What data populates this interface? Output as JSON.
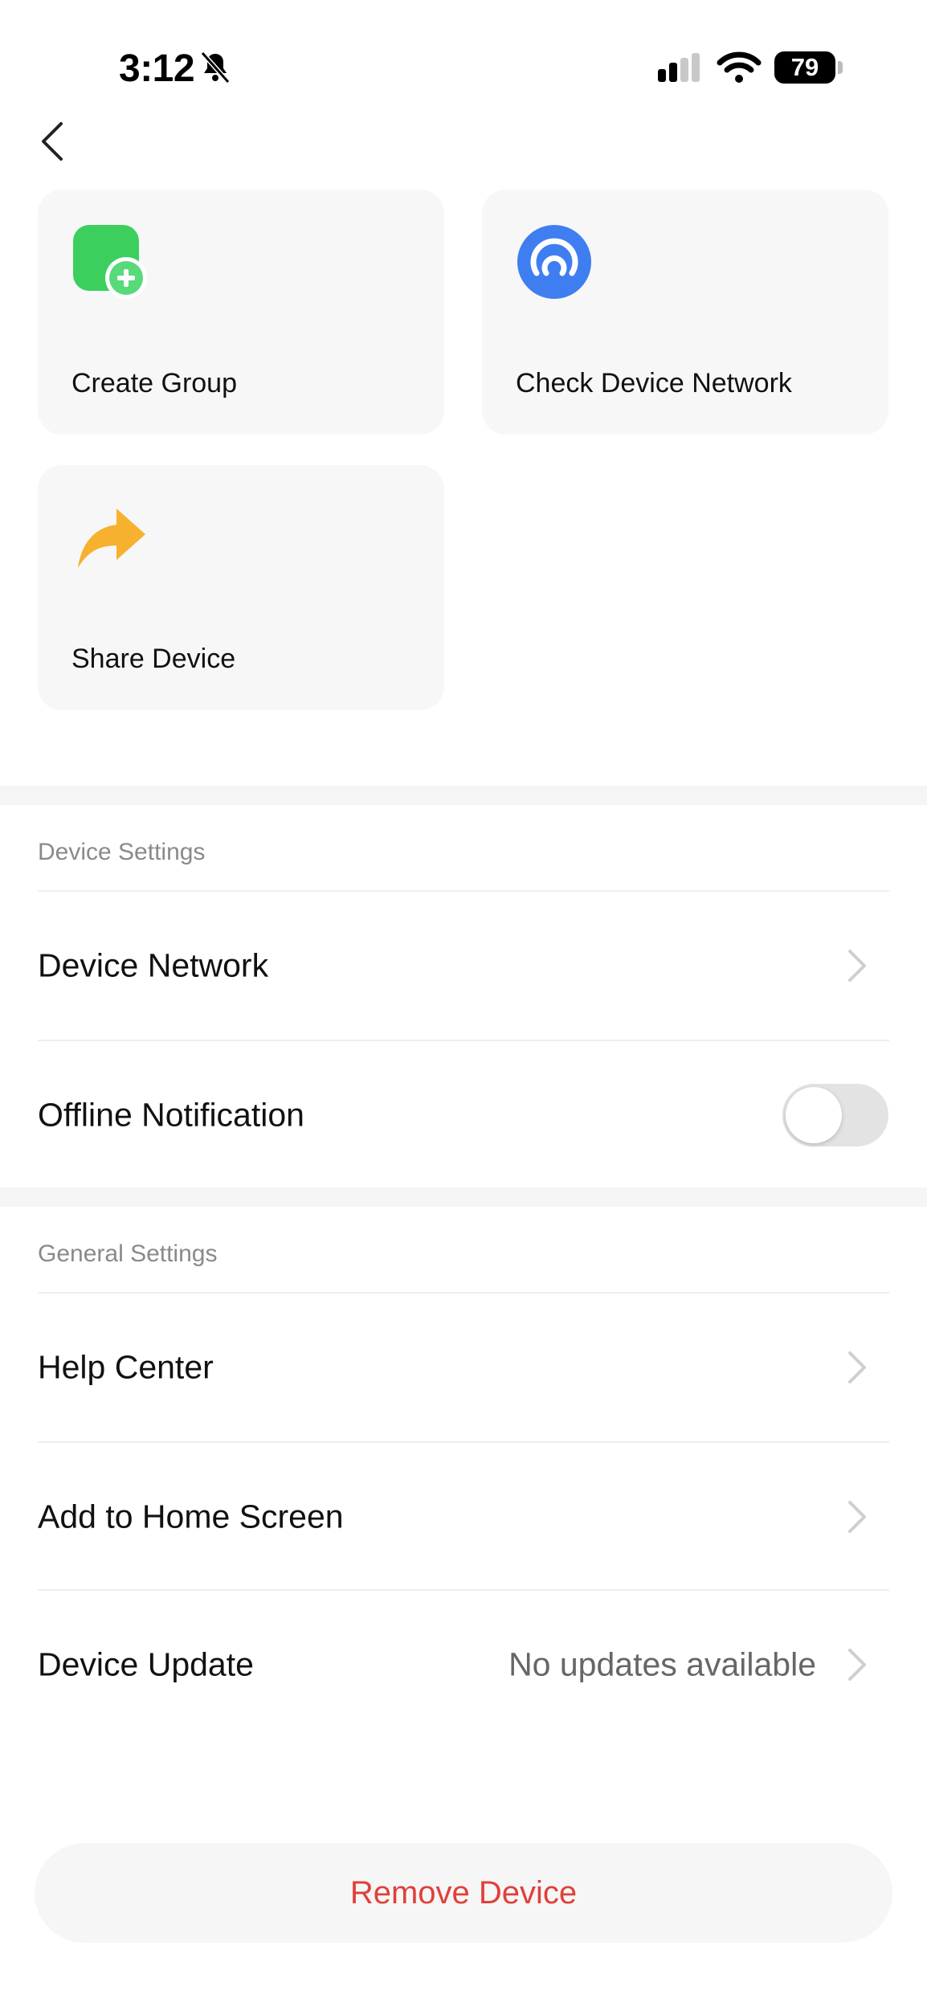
{
  "status_bar": {
    "time": "3:12",
    "battery": "79",
    "icons": [
      "bell-off-icon",
      "signal-icon",
      "wifi-icon",
      "battery-icon"
    ]
  },
  "nav": {
    "back_icon": "chevron-left-icon"
  },
  "actions": [
    {
      "label": "Create Group",
      "icon": "create-group-icon",
      "color": "#3ccf5e"
    },
    {
      "label": "Check Device Network",
      "icon": "network-check-icon",
      "color": "#3f7ef0"
    },
    {
      "label": "Share Device",
      "icon": "share-arrow-icon",
      "color": "#f7b12f"
    }
  ],
  "device_settings": {
    "title": "Device Settings",
    "items": [
      {
        "label": "Device Network"
      },
      {
        "label": "Offline Notification",
        "toggle": false
      }
    ]
  },
  "general_settings": {
    "title": "General Settings",
    "items": [
      {
        "label": "Help Center"
      },
      {
        "label": "Add to Home Screen"
      },
      {
        "label": "Device Update",
        "value": "No updates available"
      }
    ]
  },
  "remove_button": {
    "label": "Remove Device",
    "color": "#e0403a"
  }
}
